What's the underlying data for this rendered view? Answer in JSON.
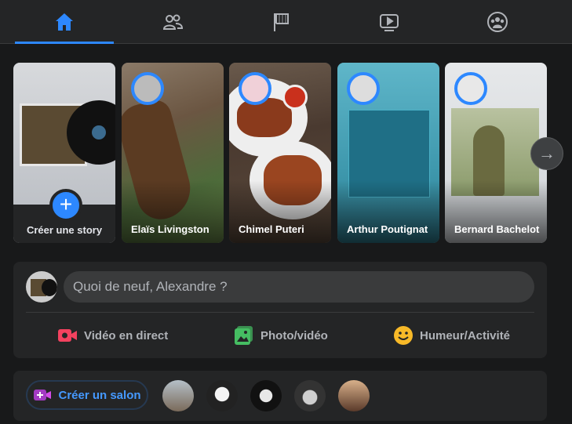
{
  "nav": {
    "tabs": [
      {
        "id": "home",
        "icon": "home-icon",
        "active": true
      },
      {
        "id": "friends",
        "icon": "friends-icon",
        "active": false
      },
      {
        "id": "pages",
        "icon": "flag-icon",
        "active": false
      },
      {
        "id": "watch",
        "icon": "video-play-icon",
        "active": false
      },
      {
        "id": "groups",
        "icon": "groups-icon",
        "active": false
      }
    ],
    "accent_color": "#2d88ff"
  },
  "stories": {
    "create_label": "Créer une story",
    "items": [
      {
        "name": "Elaïs Livingston"
      },
      {
        "name": "Chimel Puteri"
      },
      {
        "name": "Arthur Poutignat"
      },
      {
        "name": "Bernard Bachelot"
      }
    ]
  },
  "composer": {
    "placeholder": "Quoi de neuf, Alexandre ?",
    "actions": [
      {
        "label": "Vidéo en direct",
        "icon": "live-video-icon",
        "color": "#f3425f"
      },
      {
        "label": "Photo/vidéo",
        "icon": "photo-icon",
        "color": "#45bd62"
      },
      {
        "label": "Humeur/Activité",
        "icon": "emoji-icon",
        "color": "#f7b928"
      }
    ]
  },
  "rooms": {
    "button_label": "Créer un salon",
    "icon": "video-room-icon"
  }
}
